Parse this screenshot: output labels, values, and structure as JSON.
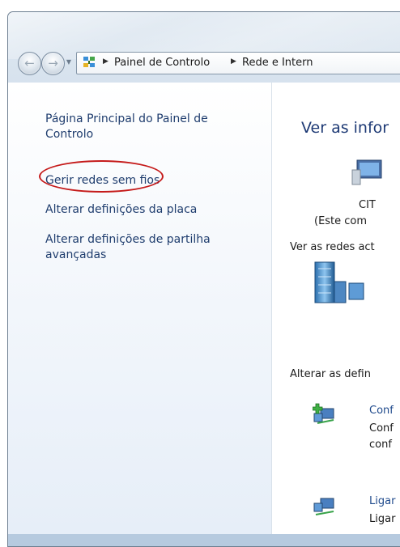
{
  "address_bar": {
    "breadcrumbs": [
      "Painel de Controlo",
      "Rede e Internet"
    ],
    "visible_crumbs": [
      "Painel de Controlo",
      "Rede e Intern"
    ],
    "icon": "control-panel-icon"
  },
  "navigation": {
    "back_icon": "back-arrow-icon",
    "forward_icon": "forward-arrow-icon",
    "recent_icon": "chevron-down-icon"
  },
  "task_pane": {
    "links": [
      {
        "label": "Página Principal do Painel de Controlo"
      },
      {
        "label": "Gerir redes sem fios",
        "highlighted": true
      },
      {
        "label": "Alterar definições da placa"
      },
      {
        "label": "Alterar definições de partilha avançadas"
      }
    ],
    "highlight_color": "#c51b1b"
  },
  "main": {
    "title": "Ver as infor",
    "computer_name": "CIT",
    "computer_caption": "(Este com",
    "active_networks_label": "Ver as redes act",
    "change_settings_label": "Alterar as defin",
    "tasks": [
      {
        "link": "Conf",
        "description_line1": "Conf",
        "description_line2": "conf",
        "icon": "network-setup-icon"
      },
      {
        "link": "Ligar",
        "description_line1": "Ligar",
        "icon": "network-connect-icon"
      }
    ]
  },
  "colors": {
    "link": "#1f3d6e",
    "title": "#1e3a75",
    "pane_bg": "#eef3fa"
  }
}
